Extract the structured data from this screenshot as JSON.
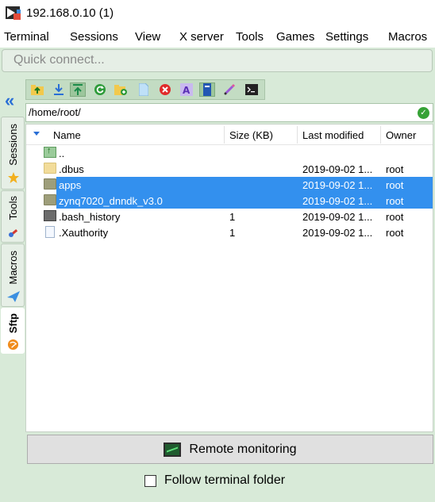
{
  "window": {
    "title": "192.168.0.10 (1)"
  },
  "menu": [
    "Terminal",
    "Sessions",
    "View",
    "X server",
    "Tools",
    "Games",
    "Settings",
    "Macros"
  ],
  "quick_connect": {
    "placeholder": "Quick connect..."
  },
  "side_tabs": [
    "Sessions",
    "Tools",
    "Macros",
    "Sftp"
  ],
  "side_tab_active": "Sftp",
  "toolbar": {
    "icons": [
      "folder-up-icon",
      "download-icon",
      "upload-icon",
      "refresh-icon",
      "new-folder-icon",
      "new-file-icon",
      "delete-icon",
      "rename-icon",
      "permissions-icon",
      "edit-icon",
      "terminal-icon"
    ]
  },
  "path": "/home/root/",
  "columns": [
    "Name",
    "Size (KB)",
    "Last modified",
    "Owner"
  ],
  "files": [
    {
      "name": "..",
      "size": "",
      "modified": "",
      "owner": "",
      "type": "updir",
      "selected": false
    },
    {
      "name": ".dbus",
      "size": "",
      "modified": "2019-09-02 1...",
      "owner": "root",
      "type": "folder",
      "selected": false
    },
    {
      "name": "apps",
      "size": "",
      "modified": "2019-09-02 1...",
      "owner": "root",
      "type": "folder-grey",
      "selected": true
    },
    {
      "name": "zynq7020_dnndk_v3.0",
      "size": "",
      "modified": "2019-09-02 1...",
      "owner": "root",
      "type": "folder-grey",
      "selected": true
    },
    {
      "name": ".bash_history",
      "size": "1",
      "modified": "2019-09-02 1...",
      "owner": "root",
      "type": "bash",
      "selected": false
    },
    {
      "name": ".Xauthority",
      "size": "1",
      "modified": "2019-09-02 1...",
      "owner": "root",
      "type": "doc",
      "selected": false
    }
  ],
  "remote_monitoring_label": "Remote monitoring",
  "follow_terminal_label": "Follow terminal folder",
  "colors": {
    "accent": "#3390ee",
    "panel": "#d8ead8"
  }
}
